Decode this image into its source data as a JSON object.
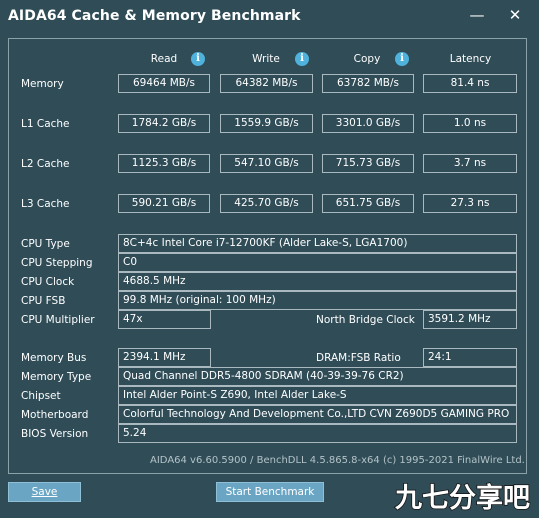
{
  "window": {
    "title": "AIDA64 Cache & Memory Benchmark",
    "minimize_glyph": "—",
    "close_glyph": "✕"
  },
  "columns": {
    "read": "Read",
    "write": "Write",
    "copy": "Copy",
    "latency": "Latency",
    "info_glyph": "i"
  },
  "bench_rows": [
    {
      "label": "Memory",
      "read": "69464 MB/s",
      "write": "64382 MB/s",
      "copy": "63782 MB/s",
      "latency": "81.4 ns"
    },
    {
      "label": "L1 Cache",
      "read": "1784.2 GB/s",
      "write": "1559.9 GB/s",
      "copy": "3301.0 GB/s",
      "latency": "1.0 ns"
    },
    {
      "label": "L2 Cache",
      "read": "1125.3 GB/s",
      "write": "547.10 GB/s",
      "copy": "715.73 GB/s",
      "latency": "3.7 ns"
    },
    {
      "label": "L3 Cache",
      "read": "590.21 GB/s",
      "write": "425.70 GB/s",
      "copy": "651.75 GB/s",
      "latency": "27.3 ns"
    }
  ],
  "cpu": {
    "type_label": "CPU Type",
    "type_value": "8C+4c Intel Core i7-12700KF  (Alder Lake-S, LGA1700)",
    "stepping_label": "CPU Stepping",
    "stepping_value": "C0",
    "clock_label": "CPU Clock",
    "clock_value": "4688.5 MHz",
    "fsb_label": "CPU FSB",
    "fsb_value": "99.8 MHz  (original: 100 MHz)",
    "multiplier_label": "CPU Multiplier",
    "multiplier_value": "47x",
    "nb_clock_label": "North Bridge Clock",
    "nb_clock_value": "3591.2 MHz"
  },
  "system": {
    "membus_label": "Memory Bus",
    "membus_value": "2394.1 MHz",
    "dramfsb_label": "DRAM:FSB Ratio",
    "dramfsb_value": "24:1",
    "memtype_label": "Memory Type",
    "memtype_value": "Quad Channel DDR5-4800 SDRAM  (40-39-39-76 CR2)",
    "chipset_label": "Chipset",
    "chipset_value": "Intel Alder Point-S Z690, Intel Alder Lake-S",
    "mobo_label": "Motherboard",
    "mobo_value": "Colorful Technology And Development Co.,LTD CVN Z690D5 GAMING PRO",
    "bios_label": "BIOS Version",
    "bios_value": "5.24"
  },
  "footer": {
    "text": "AIDA64 v6.60.5900 / BenchDLL 4.5.865.8-x64  (c) 1995-2021 FinalWire Ltd."
  },
  "buttons": {
    "save": "Save",
    "start": "Start Benchmark"
  },
  "watermark": {
    "text": "九七分享吧"
  },
  "colors": {
    "background": "#2f4c57",
    "button": "#6aa6c4",
    "info_icon": "#4fb2dc",
    "border": "#a9b9bf"
  }
}
